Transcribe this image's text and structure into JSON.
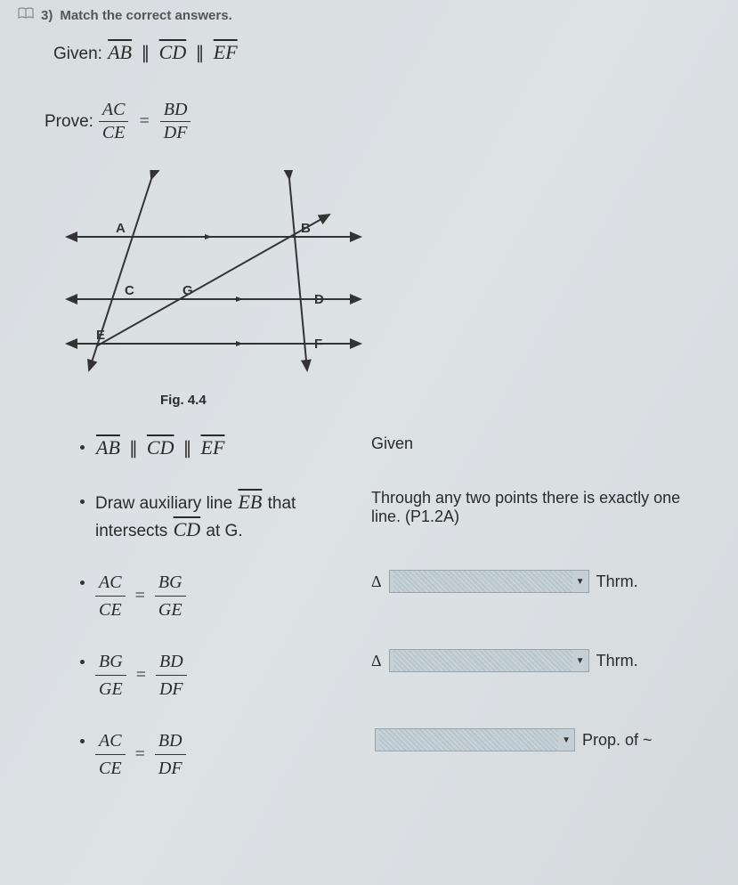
{
  "header": {
    "number": "3)",
    "title": "Match the correct answers."
  },
  "given": {
    "label": "Given:",
    "seg1": "AB",
    "seg2": "CD",
    "seg3": "EF"
  },
  "prove": {
    "label": "Prove:",
    "f1n": "AC",
    "f1d": "CE",
    "f2n": "BD",
    "f2d": "DF"
  },
  "diagram": {
    "caption": "Fig. 4.4",
    "points": {
      "A": "A",
      "B": "B",
      "C": "C",
      "D": "D",
      "E": "E",
      "F": "F",
      "G": "G"
    }
  },
  "proof": {
    "r1": {
      "s_seg1": "AB",
      "s_seg2": "CD",
      "s_seg3": "EF",
      "reason": "Given"
    },
    "r2": {
      "s_pre": "Draw auxiliary line ",
      "s_seg": "EB",
      "s_mid": " that intersects ",
      "s_seg2": "CD",
      "s_post": " at G.",
      "reason": "Through any two points there is exactly one line. (P1.2A)"
    },
    "r3": {
      "f1n": "AC",
      "f1d": "CE",
      "f2n": "BG",
      "f2d": "GE",
      "r_pre": "Δ",
      "r_post": "Thrm."
    },
    "r4": {
      "f1n": "BG",
      "f1d": "GE",
      "f2n": "BD",
      "f2d": "DF",
      "r_pre": "Δ",
      "r_post": "Thrm."
    },
    "r5": {
      "f1n": "AC",
      "f1d": "CE",
      "f2n": "BD",
      "f2d": "DF",
      "r_post": "Prop. of ~"
    }
  }
}
